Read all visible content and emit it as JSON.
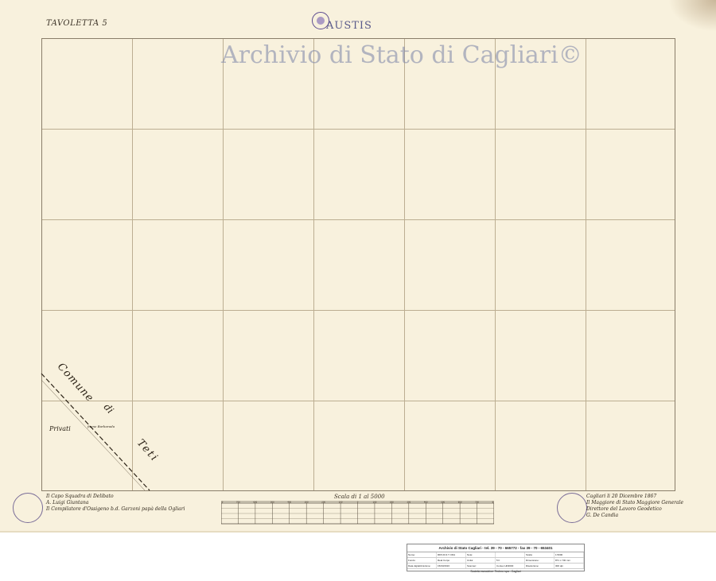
{
  "map": {
    "sheet_label": "TAVOLETTA 5",
    "comune_title": "AUSTIS",
    "watermark": "Archivio di Stato di Cagliari©",
    "labels": {
      "comune": "Comune",
      "di": "di",
      "teti": "Teti",
      "privati": "Privati",
      "field_note": "fiume Barbarada"
    },
    "scale_title": "Scala di 1 al 5000",
    "scale_ticks": [
      "800",
      "700",
      "600",
      "500",
      "400",
      "300",
      "200",
      "100",
      "0",
      "100",
      "200",
      "300",
      "400",
      "500",
      "600",
      "700",
      "800"
    ],
    "handwriting_left": [
      "Il Capo Squadra di Delibato",
      "A. Luigi Giuntana",
      "Il Compilatore d'Ossigeno b.d. Garzoni papà della Ogliari"
    ],
    "handwriting_right": [
      "Cagliari li 20 Dicembre 1867",
      "Il Maggiore di Stato Maggiore Generale",
      "Direttore del Lavoro Geodetico",
      "G. De Candia"
    ],
    "colors": {
      "paper": "#f8f1dd",
      "grid": "#bcae92",
      "ink": "#2d2418",
      "watermark": "#7882a5"
    }
  },
  "info_box": {
    "title": "Archivio di Stato Cagliari - tel. 39 - 70 - 665772 - fax 39 - 70 - 653401",
    "rows": [
      [
        "Nome:",
        "RDS R.D.T. DFA",
        "Note:",
        "",
        "Scala:",
        "1:5000"
      ],
      [
        "Fondo:",
        "Real Corpo",
        "Unità:",
        "5 F",
        "Dimensione:",
        "871 x 730 mm"
      ],
      [
        "Data digitalizzazione:",
        "15/03/2016",
        "Scanner:",
        "Contex HD3630",
        "Risoluzione:",
        "300 dpi"
      ]
    ],
    "footer": "Società esecutrice: Techno spa - Cagliari"
  }
}
